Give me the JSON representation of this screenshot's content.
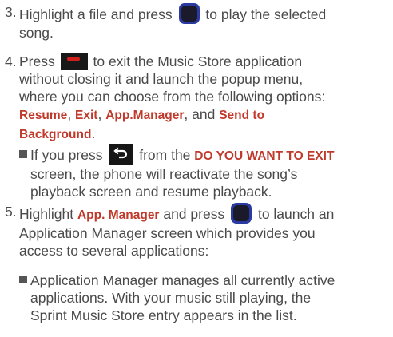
{
  "step3": {
    "num": "3.",
    "text_a": "Highlight a file and press",
    "text_b": "to play the selected",
    "text_c": "song."
  },
  "step4": {
    "num": "4.",
    "text_a": "Press",
    "text_b": "to exit the Music Store application",
    "line2": "without closing it and launch the popup menu,",
    "line3": "where you can choose from the following options:",
    "opt_resume": "Resume",
    "sep1": ", ",
    "opt_exit": "Exit",
    "sep2": ", ",
    "opt_appmanager": "App.Manager",
    "sep3": ", and ",
    "opt_send": "Send to",
    "opt_background": "Background",
    "period": ".",
    "bullet": {
      "text_a": "If you press",
      "text_b": "from the",
      "screen_name": "DO YOU WANT TO EXIT",
      "line2": "screen, the phone will reactivate the song’s",
      "line3": "playback screen and resume playback."
    }
  },
  "step5": {
    "num": "5.",
    "text_a": "Highlight",
    "bold_app": "App. Manager",
    "text_b": "and press",
    "text_c": "to launch an",
    "line2": "Application Manager screen which provides you",
    "line3": "access to several applications:",
    "bullet": {
      "line1": "Application Manager manages all currently active",
      "line2": "applications. With your music still playing, the",
      "line3": "Sprint Music Store entry appears in the list."
    }
  },
  "icons": {
    "ok": "ok-key-icon",
    "end": "end-key-icon",
    "back": "back-key-icon"
  }
}
